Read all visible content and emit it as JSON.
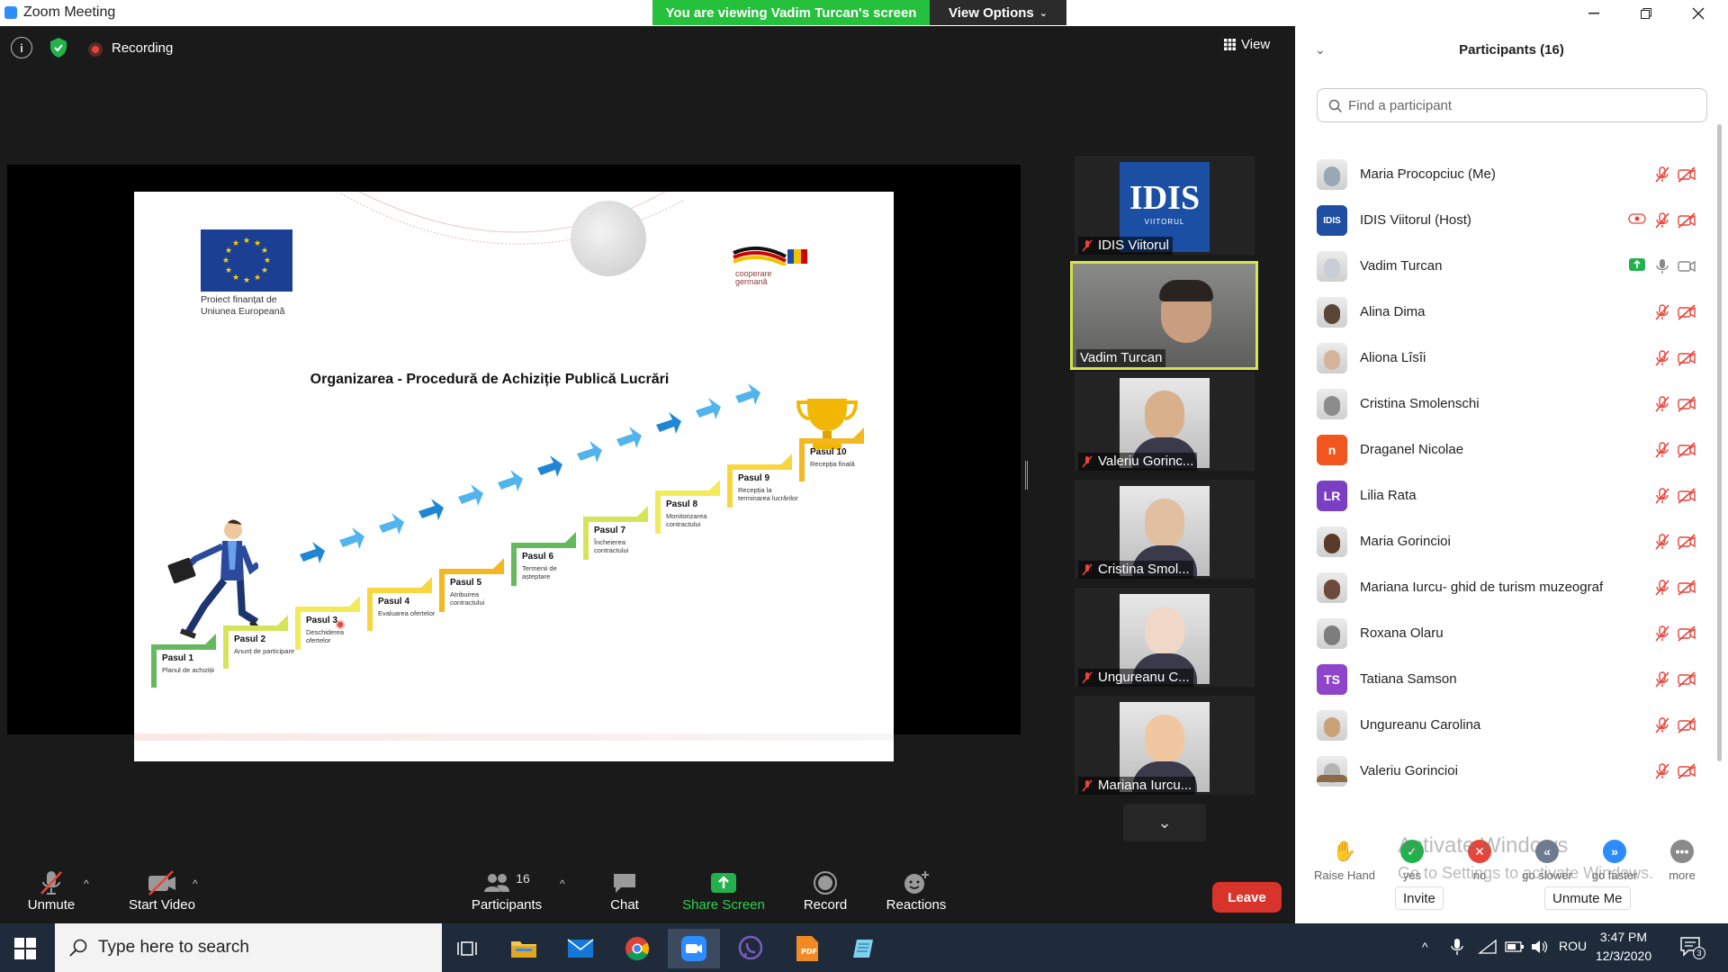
{
  "window": {
    "title": "Zoom Meeting"
  },
  "banner": {
    "viewing": "You are viewing Vadim Turcan's screen",
    "view_options": "View Options"
  },
  "meeting_bar": {
    "recording": "Recording",
    "view": "View"
  },
  "slide": {
    "eu_caption": "Proiect finanțat de Uniunea Europeană",
    "partner_line1": "cooperare",
    "partner_line2": "germană",
    "title": "Organizarea - Procedură de Achiziție Publică Lucrări",
    "steps": [
      {
        "title": "Pasul 1",
        "desc": "Planul de achiziții"
      },
      {
        "title": "Pasul 2",
        "desc": "Anunț de participare"
      },
      {
        "title": "Pasul 3",
        "desc": "Deschiderea ofertelor"
      },
      {
        "title": "Pasul 4",
        "desc": "Evaluarea ofertelor"
      },
      {
        "title": "Pasul 5",
        "desc": "Atribuirea contractului"
      },
      {
        "title": "Pasul 6",
        "desc": "Termenii de așteptare"
      },
      {
        "title": "Pasul 7",
        "desc": "Încheierea contractului"
      },
      {
        "title": "Pasul 8",
        "desc": "Monitorizarea contractului"
      },
      {
        "title": "Pasul 9",
        "desc": "Recepția la terminarea lucrărilor"
      },
      {
        "title": "Pasul 10",
        "desc": "Recepția finală"
      }
    ]
  },
  "thumbnails": [
    {
      "name": "IDIS Viitorul",
      "logo": "IDIS",
      "logo_sub": "VIITORUL",
      "muted": true
    },
    {
      "name": "Vadim Turcan",
      "active": true,
      "muted": false
    },
    {
      "name": "Valeriu Gorinc...",
      "muted": true
    },
    {
      "name": "Cristina Smol...",
      "muted": true
    },
    {
      "name": "Ungureanu C...",
      "muted": true
    },
    {
      "name": "Mariana Iurcu...",
      "muted": true
    }
  ],
  "toolbar": {
    "unmute": "Unmute",
    "start_video": "Start Video",
    "participants": "Participants",
    "participant_count": "16",
    "chat": "Chat",
    "share_screen": "Share Screen",
    "record": "Record",
    "reactions": "Reactions",
    "leave": "Leave"
  },
  "panel": {
    "title": "Participants (16)",
    "search_placeholder": "Find a participant",
    "participants": [
      {
        "name": "Maria Procopciuc (Me)",
        "avatar": "photo",
        "color": "#9aa7b5"
      },
      {
        "name": "IDIS Viitorul (Host)",
        "avatar": "logo",
        "color": "#1e4fa3",
        "initials": "IDIS"
      },
      {
        "name": "Vadim Turcan",
        "avatar": "photo",
        "color": "#c9ced6",
        "sharing": true
      },
      {
        "name": "Alina Dima",
        "avatar": "photo",
        "color": "#5a4636"
      },
      {
        "name": "Aliona Lîsîi",
        "avatar": "photo",
        "color": "#d6b49a"
      },
      {
        "name": "Cristina Smolenschi",
        "avatar": "photo",
        "color": "#8c8c8c"
      },
      {
        "name": "Draganel Nicolae",
        "avatar": "initial",
        "color": "#f0561d",
        "initials": "n"
      },
      {
        "name": "Lilia Rata",
        "avatar": "initial",
        "color": "#7b3fc4",
        "initials": "LR"
      },
      {
        "name": "Maria Gorincioi",
        "avatar": "photo",
        "color": "#5b3a2a"
      },
      {
        "name": "Mariana Iurcu- ghid de turism muzeograf",
        "avatar": "photo",
        "color": "#6e4a3a"
      },
      {
        "name": "Roxana Olaru",
        "avatar": "photo",
        "color": "#7d7d7d"
      },
      {
        "name": "Tatiana Samson",
        "avatar": "initial",
        "color": "#8e45c9",
        "initials": "TS"
      },
      {
        "name": "Ungureanu Carolina",
        "avatar": "photo",
        "color": "#c9a27a"
      },
      {
        "name": "Valeriu Gorincioi",
        "avatar": "photo",
        "color": "#b4b4b4"
      }
    ],
    "reactions": [
      {
        "label": "Raise Hand",
        "color": "#2D8CFF",
        "glyph": "✋"
      },
      {
        "label": "yes",
        "color": "#21b24b",
        "glyph": "✓"
      },
      {
        "label": "no",
        "color": "#e8443a",
        "glyph": "✕"
      },
      {
        "label": "go slower",
        "color": "#6d7c91",
        "glyph": "«"
      },
      {
        "label": "go faster",
        "color": "#2D8CFF",
        "glyph": "»"
      },
      {
        "label": "more",
        "color": "#8a8a8a",
        "glyph": "•••"
      }
    ],
    "invite": "Invite",
    "unmute_me": "Unmute Me",
    "watermark_title": "Activate Windows",
    "watermark_sub": "Go to Settings to activate Windows."
  },
  "taskbar": {
    "search_placeholder": "Type here to search",
    "language": "ROU",
    "time": "3:47 PM",
    "date": "12/3/2020",
    "notifications": "3"
  }
}
